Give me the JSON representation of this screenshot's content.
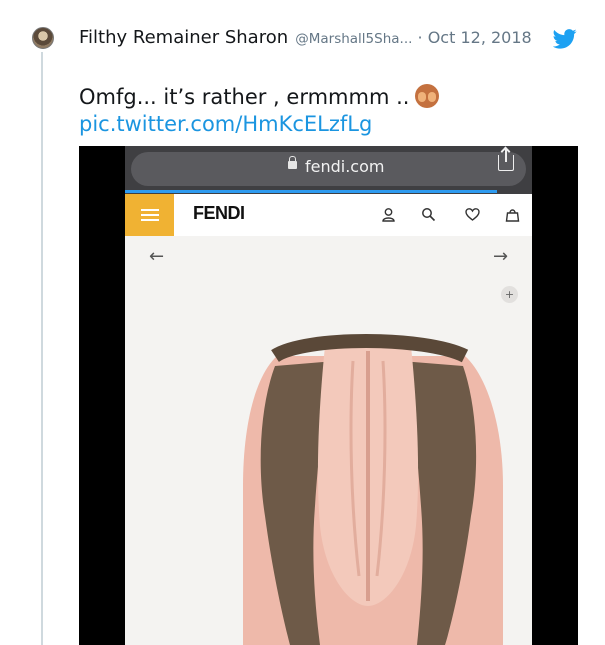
{
  "tweet": {
    "author_name": "Filthy Remainer Sharon",
    "handle": "@Marshall5Sha...",
    "separator": "·",
    "date": "Oct 12, 2018",
    "text": "Omfg... it’s rather , ermmmm ..",
    "emoji": "see-no-evil-monkey-icon",
    "link": "pic.twitter.com/HmKcELzfLg"
  },
  "media": {
    "browser": {
      "domain": "fendi.com"
    },
    "site": {
      "brand": "FENDI"
    },
    "nav": {
      "back": "←",
      "forward": "→",
      "zoom": "+"
    }
  },
  "colors": {
    "link": "#1b95e0",
    "brand_menu": "#f0b233",
    "scarf_pink": "#f0c2b3",
    "fur": "#6e5a48"
  }
}
